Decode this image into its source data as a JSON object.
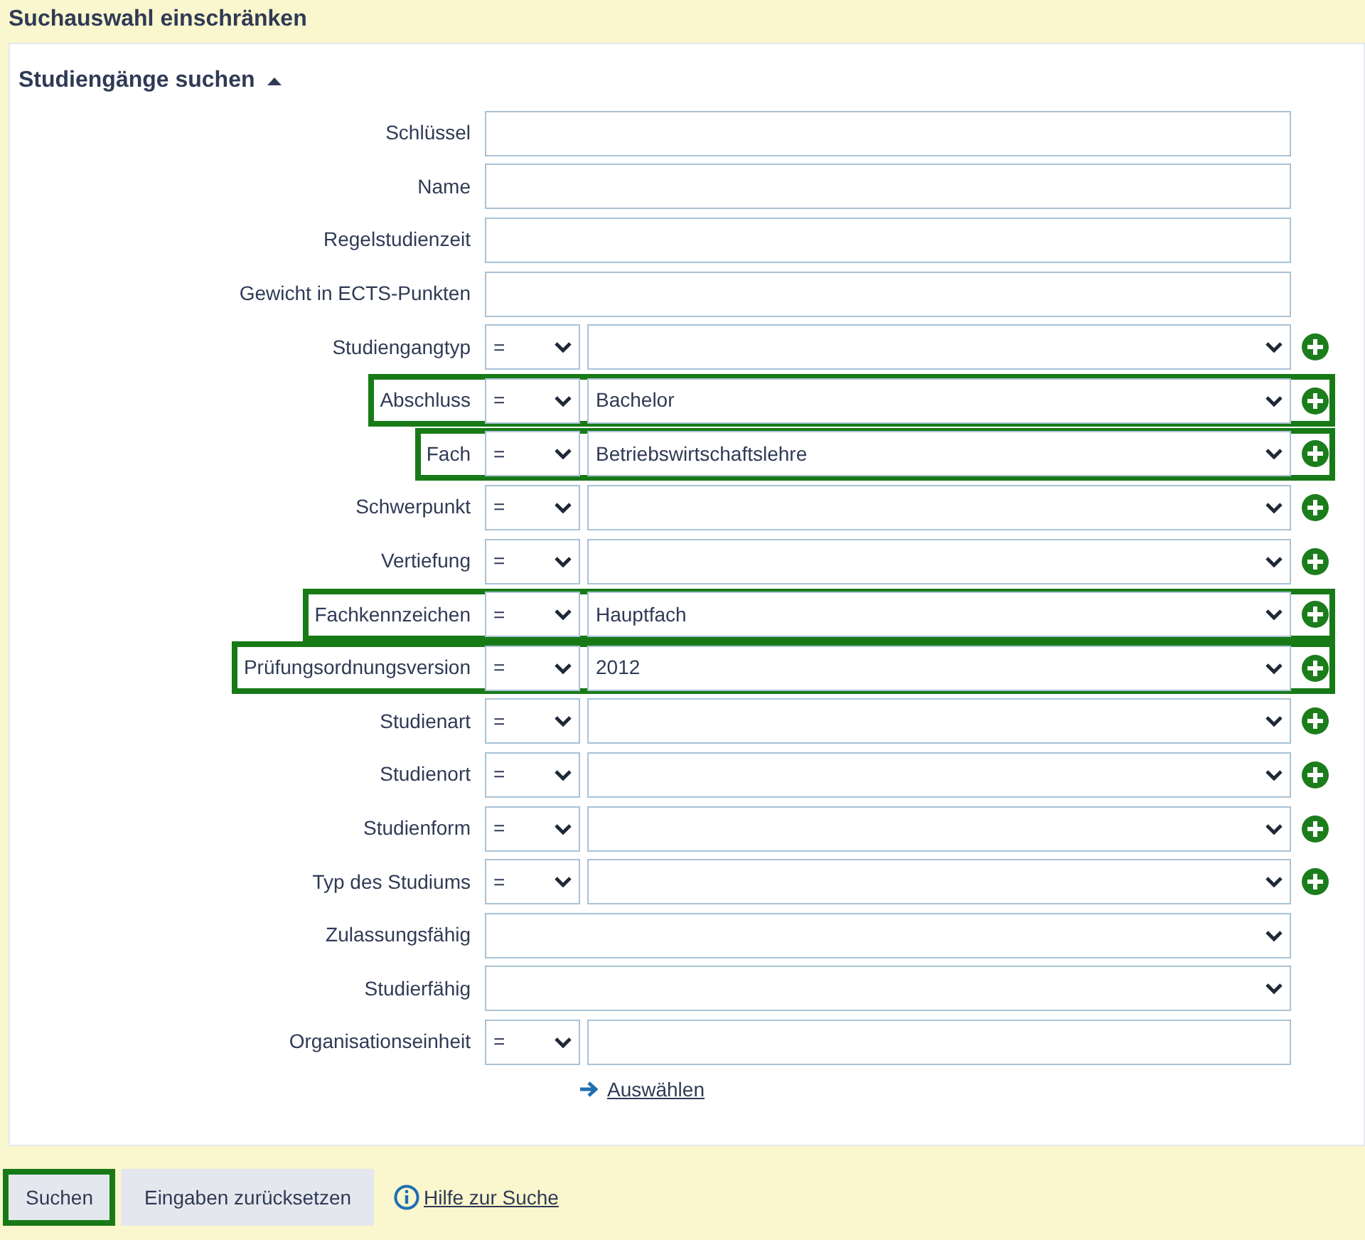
{
  "title": "Suchauswahl einschränken",
  "section": {
    "title": "Studiengänge suchen",
    "expanded": true
  },
  "rows": [
    {
      "label": "Schlüssel",
      "kind": "text",
      "highlighted": false
    },
    {
      "label": "Name",
      "kind": "text",
      "highlighted": false
    },
    {
      "label": "Regelstudienzeit",
      "kind": "text",
      "highlighted": false
    },
    {
      "label": "Gewicht in ECTS-Punkten",
      "kind": "text",
      "highlighted": false
    },
    {
      "label": "Studiengangtyp",
      "kind": "operator_select",
      "operator": "=",
      "highlighted": false
    },
    {
      "label": "Abschluss",
      "kind": "operator_select",
      "operator": "=",
      "value": "Bachelor",
      "highlighted": true
    },
    {
      "label": "Fach",
      "kind": "operator_select",
      "operator": "=",
      "value": "Betriebswirtschaftslehre",
      "highlighted": true
    },
    {
      "label": "Schwerpunkt",
      "kind": "operator_select",
      "operator": "=",
      "highlighted": false
    },
    {
      "label": "Vertiefung",
      "kind": "operator_select",
      "operator": "=",
      "highlighted": false
    },
    {
      "label": "Fachkennzeichen",
      "kind": "operator_select",
      "operator": "=",
      "value": "Hauptfach",
      "highlighted": true
    },
    {
      "label": "Prüfungsordnungsversion",
      "kind": "operator_select",
      "operator": "=",
      "value": "2012",
      "highlighted": true
    },
    {
      "label": "Studienart",
      "kind": "operator_select",
      "operator": "=",
      "highlighted": false
    },
    {
      "label": "Studienort",
      "kind": "operator_select",
      "operator": "=",
      "highlighted": false
    },
    {
      "label": "Studienform",
      "kind": "operator_select",
      "operator": "=",
      "highlighted": false
    },
    {
      "label": "Typ des Studiums",
      "kind": "operator_select",
      "operator": "=",
      "highlighted": false
    },
    {
      "label": "Zulassungsfähig",
      "kind": "select",
      "highlighted": false
    },
    {
      "label": "Studierfähig",
      "kind": "select",
      "highlighted": false
    },
    {
      "label": "Organisationseinheit",
      "kind": "operator_text",
      "operator": "=",
      "highlighted": false
    }
  ],
  "select_link": "Auswählen",
  "buttons": [
    {
      "label": "Suchen",
      "highlighted": true
    },
    {
      "label": "Eingaben zurücksetzen",
      "highlighted": false
    }
  ],
  "help_link": "Hilfe zur Suche"
}
